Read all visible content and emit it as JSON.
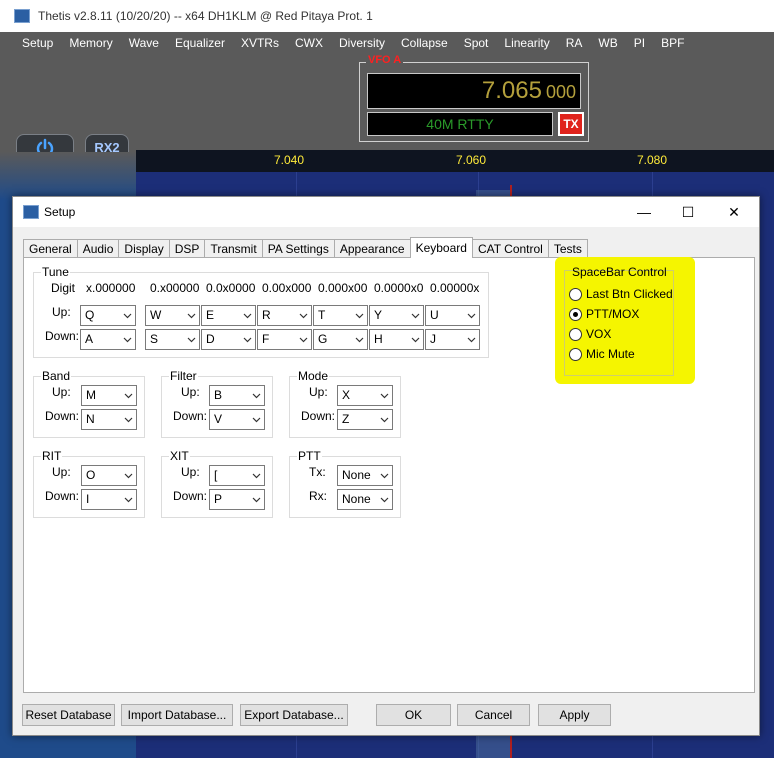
{
  "main_window": {
    "title": "Thetis v2.8.11 (10/20/20)   --   x64 DH1KLM @ Red Pitaya Prot. 1",
    "menu": [
      "Setup",
      "Memory",
      "Wave",
      "Equalizer",
      "XVTRs",
      "CWX",
      "Diversity",
      "Collapse",
      "Spot",
      "Linearity",
      "RA",
      "WB",
      "PI",
      "BPF"
    ],
    "vfo": {
      "label": "VFO A",
      "freq_main": "7.065",
      "freq_sub": "000",
      "mode": "40M RTTY",
      "tx_label": "TX"
    },
    "rx2_label": "RX2",
    "scale_ticks": [
      "7.040",
      "7.060",
      "7.080"
    ]
  },
  "dialog": {
    "title": "Setup",
    "window_buttons": {
      "minimize": "—",
      "maximize": "☐",
      "close": "✕"
    },
    "tabs": [
      "General",
      "Audio",
      "Display",
      "DSP",
      "Transmit",
      "PA Settings",
      "Appearance",
      "Keyboard",
      "CAT Control",
      "Tests"
    ],
    "active_tab": "Keyboard",
    "tune": {
      "legend": "Tune",
      "digit_label": "Digit",
      "digits": [
        "x.000000",
        "0.x00000",
        "0.0x0000",
        "0.00x000",
        "0.000x00",
        "0.0000x0",
        "0.00000x"
      ],
      "up_label": "Up:",
      "down_label": "Down:",
      "up_values": [
        "Q",
        "W",
        "E",
        "R",
        "T",
        "Y",
        "U"
      ],
      "down_values": [
        "A",
        "S",
        "D",
        "F",
        "G",
        "H",
        "J"
      ]
    },
    "band": {
      "legend": "Band",
      "up_label": "Up:",
      "down_label": "Down:",
      "up": "M",
      "down": "N"
    },
    "filter": {
      "legend": "Filter",
      "up_label": "Up:",
      "down_label": "Down:",
      "up": "B",
      "down": "V"
    },
    "mode": {
      "legend": "Mode",
      "up_label": "Up:",
      "down_label": "Down:",
      "up": "X",
      "down": "Z"
    },
    "rit": {
      "legend": "RIT",
      "up_label": "Up:",
      "down_label": "Down:",
      "up": "O",
      "down": "I"
    },
    "xit": {
      "legend": "XIT",
      "up_label": "Up:",
      "down_label": "Down:",
      "up": "[",
      "down": "P"
    },
    "ptt": {
      "legend": "PTT",
      "tx_label": "Tx:",
      "rx_label": "Rx:",
      "tx": "None",
      "rx": "None"
    },
    "spacebar": {
      "legend": "SpaceBar Control",
      "options": [
        "Last Btn Clicked",
        "PTT/MOX",
        "VOX",
        "Mic Mute"
      ],
      "selected": "PTT/MOX"
    },
    "buttons": {
      "reset_db": "Reset Database",
      "import_db": "Import Database...",
      "export_db": "Export Database...",
      "ok": "OK",
      "cancel": "Cancel",
      "apply": "Apply"
    }
  },
  "colors": {
    "highlight": "#f5f500",
    "vfo_label": "#ff2020",
    "vfo_digits": "#b4a03c",
    "mode_text": "#2a9a2a",
    "scale_text": "#ffeb3a",
    "tx_button": "#e0231c"
  }
}
